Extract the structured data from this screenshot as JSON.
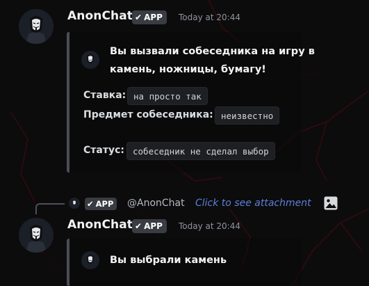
{
  "messages": [
    {
      "username": "AnonChat",
      "app_badge": "APP",
      "timestamp": "Today at 20:44",
      "embed": {
        "title_line1": "Вы вызвали собеседника на игру в",
        "title_line2": "камень, ножницы, бумагу!",
        "fields": [
          {
            "name": "Ставка:",
            "value": "на просто так"
          },
          {
            "name": "Предмет собеседника:",
            "value": "неизвестно"
          },
          {
            "name": "Статус:",
            "value": "собеседник не сделал выбор"
          }
        ]
      }
    },
    {
      "reply": {
        "app_badge": "APP",
        "mention": "@AnonChat",
        "preview": "Click to see attachment"
      },
      "username": "AnonChat",
      "app_badge": "APP",
      "timestamp": "Today at 20:44",
      "embed": {
        "title": "Вы выбрали камень"
      }
    }
  ],
  "icons": {
    "avatar": "anonymous-mask-avatar",
    "check": "checkmark-icon",
    "attachment": "image-icon"
  },
  "colors": {
    "background": "#0c0c0d",
    "accent_link": "#5b7fd8",
    "embed_bar": "#4b4e55",
    "badge_bg": "#3a3c43",
    "decor_red": "#3a0a0c"
  }
}
